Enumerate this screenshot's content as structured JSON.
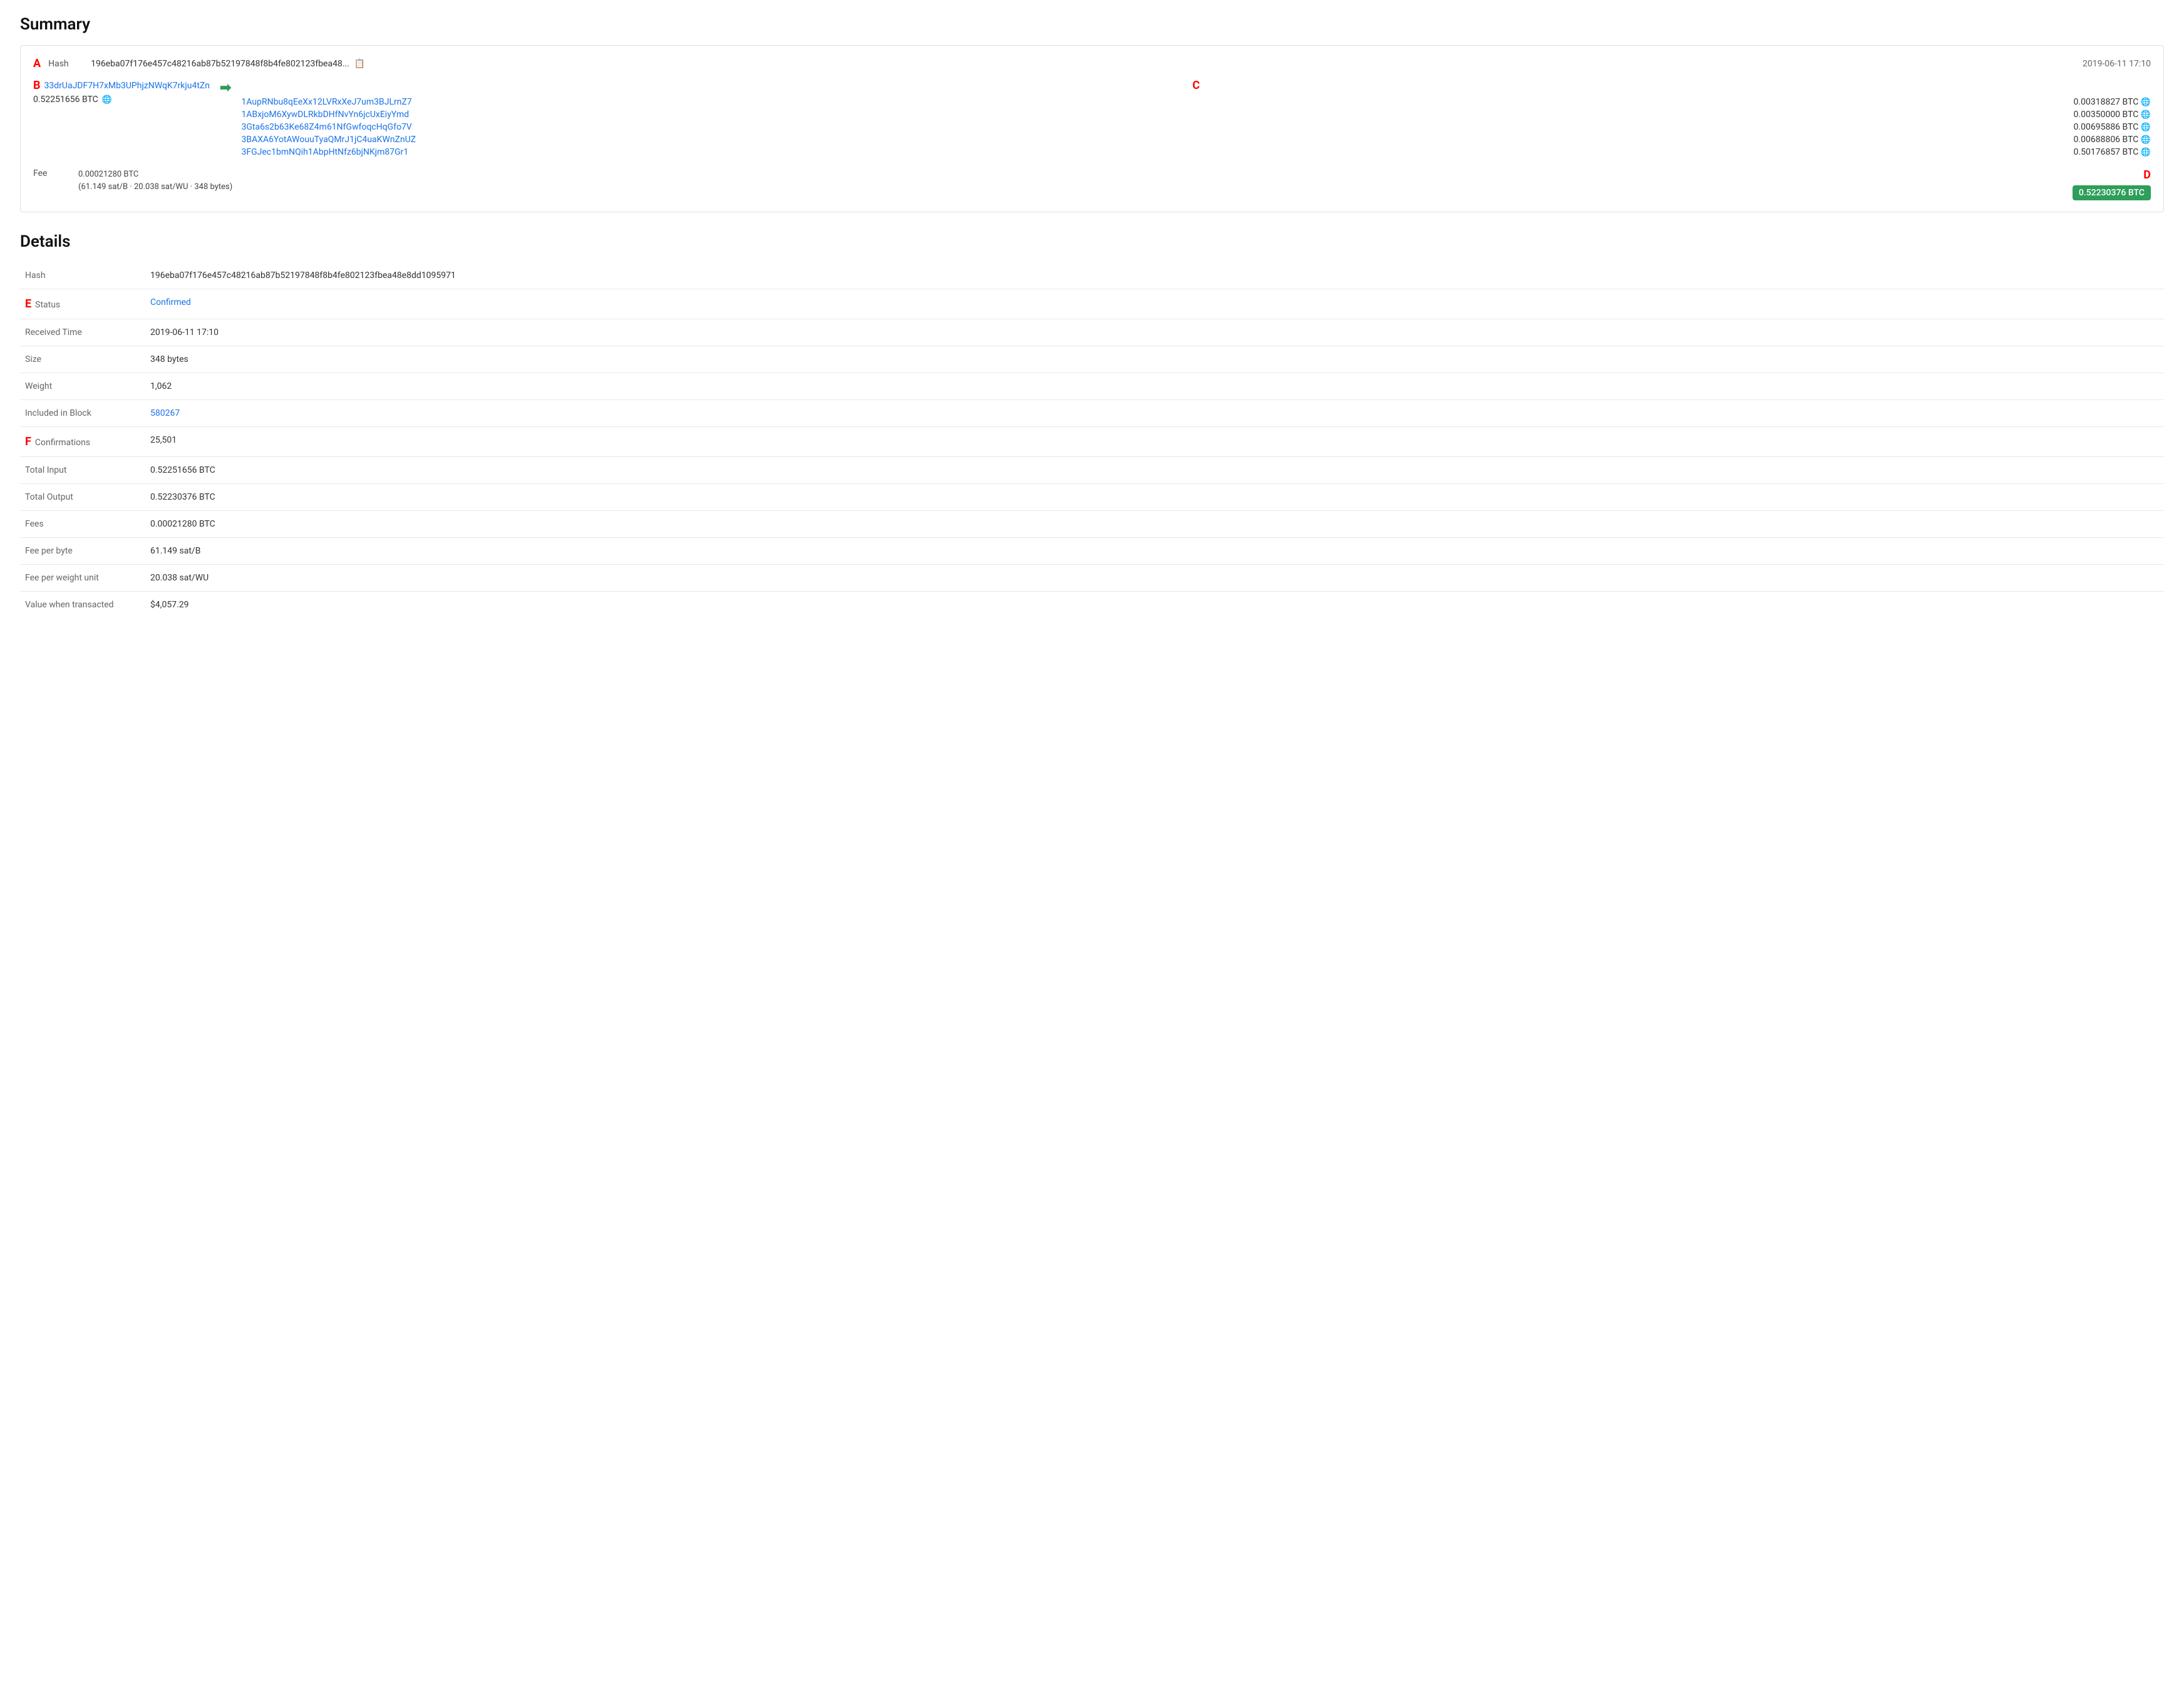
{
  "page": {
    "summary_title": "Summary",
    "details_title": "Details"
  },
  "summary": {
    "hash_label": "Hash",
    "hash_short": "196eba07f176e457c48216ab87b52197848f8b4fe802123fbea48...",
    "timestamp": "2019-06-11 17:10",
    "input_address": "33drUaJDF7H7xMb3UPhjzNWqK7rkju4tZn",
    "input_amount": "0.52251656 BTC",
    "outputs": [
      {
        "address": "1AupRNbu8qEeXx12LVRxXeJ7um3BJLrnZ7",
        "amount": "0.00318827 BTC"
      },
      {
        "address": "1ABxjoM6XywDLRkbDHfNvYn6jcUxEiyYmd",
        "amount": "0.00350000 BTC"
      },
      {
        "address": "3Gta6s2b63Ke68Z4m61NfGwfoqcHqGfo7V",
        "amount": "0.00695886 BTC"
      },
      {
        "address": "3BAXA6YotAWouuTyaQMrJ1jC4uaKWnZnUZ",
        "amount": "0.00688806 BTC"
      },
      {
        "address": "3FGJec1bmNQih1AbpHtNfz6bjNKjm87Gr1",
        "amount": "0.50176857 BTC"
      }
    ],
    "fee_label": "Fee",
    "fee_main": "0.00021280 BTC",
    "fee_detail": "(61.149 sat/B · 20.038 sat/WU · 348 bytes)",
    "total_output": "0.52230376 BTC",
    "annotation_a": "A",
    "annotation_b": "B",
    "annotation_c": "C",
    "annotation_d": "D"
  },
  "details": {
    "rows": [
      {
        "label": "Hash",
        "value": "196eba07f176e457c48216ab87b52197848f8b4fe802123fbea48e8dd1095971",
        "type": "text"
      },
      {
        "label": "Status",
        "value": "Confirmed",
        "type": "status"
      },
      {
        "label": "Received Time",
        "value": "2019-06-11 17:10",
        "type": "text"
      },
      {
        "label": "Size",
        "value": "348 bytes",
        "type": "text"
      },
      {
        "label": "Weight",
        "value": "1,062",
        "type": "text"
      },
      {
        "label": "Included in Block",
        "value": "580267",
        "type": "link"
      },
      {
        "label": "Confirmations",
        "value": "25,501",
        "type": "text"
      },
      {
        "label": "Total Input",
        "value": "0.52251656 BTC",
        "type": "text"
      },
      {
        "label": "Total Output",
        "value": "0.52230376 BTC",
        "type": "text"
      },
      {
        "label": "Fees",
        "value": "0.00021280 BTC",
        "type": "text"
      },
      {
        "label": "Fee per byte",
        "value": "61.149 sat/B",
        "type": "text"
      },
      {
        "label": "Fee per weight unit",
        "value": "20.038 sat/WU",
        "type": "text"
      },
      {
        "label": "Value when transacted",
        "value": "$4,057.29",
        "type": "text"
      }
    ],
    "annotation_e": "E",
    "annotation_f": "F"
  }
}
